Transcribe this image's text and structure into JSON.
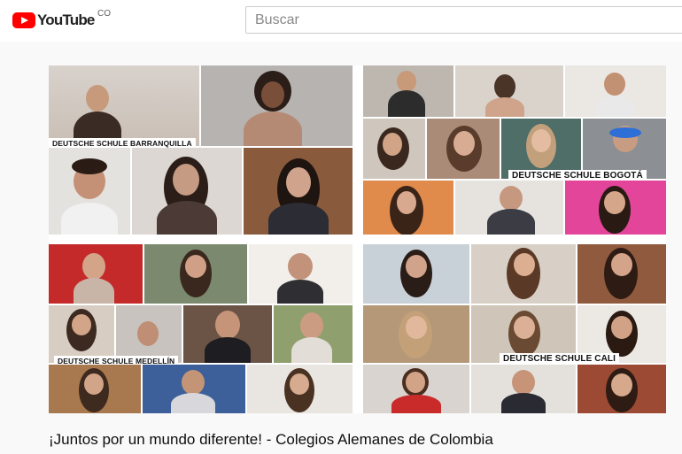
{
  "header": {
    "logo_text": "YouTube",
    "country_code": "CO",
    "logo_icon": "youtube-play-icon",
    "brand_color": "#ff0000"
  },
  "search": {
    "placeholder": "Buscar"
  },
  "video": {
    "school_labels": {
      "barranquilla": "DEUTSCHE SCHULE BARRANQUILLA",
      "bogota": "DEUTSCHE SCHULE BOGOTÁ",
      "medellin": "DEUTSCHE SCHULE MEDELLÍN",
      "cali": "DEUTSCHE SCHULE CALI"
    },
    "title": "¡Juntos por un mundo diferente! - Colegios Alemanes de Colombia"
  }
}
